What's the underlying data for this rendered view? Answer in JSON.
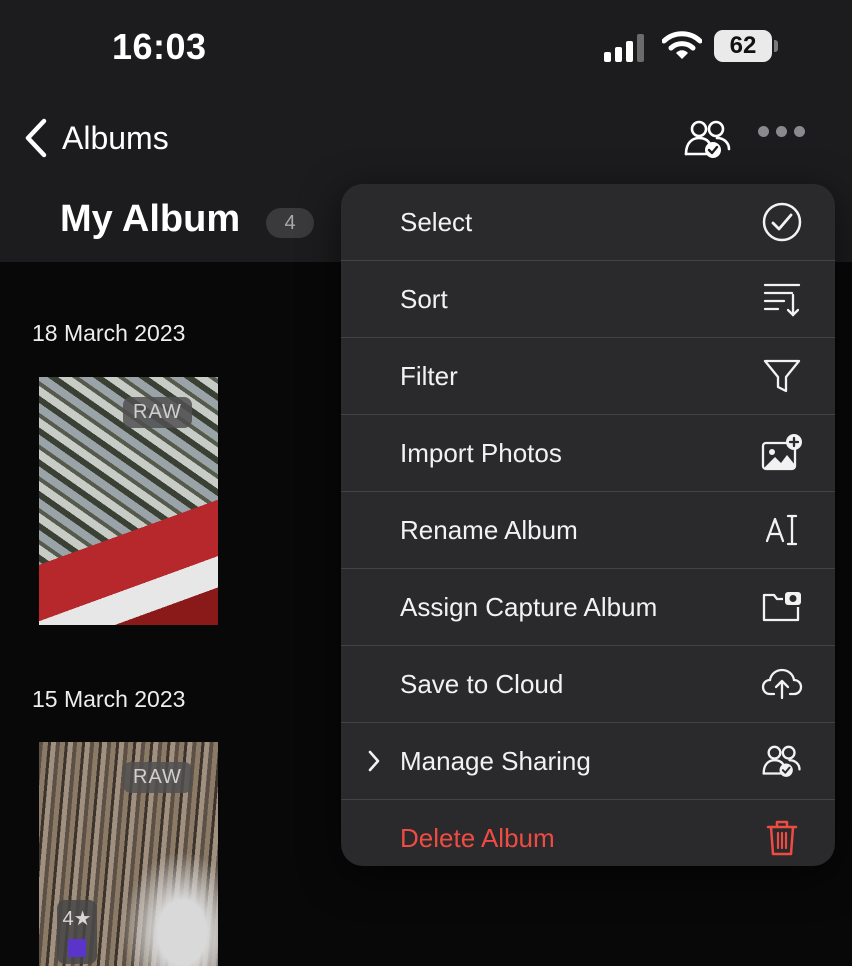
{
  "status_bar": {
    "time": "16:03",
    "battery": "62"
  },
  "nav": {
    "back_label": "Albums"
  },
  "album": {
    "title": "My Album",
    "count": "4"
  },
  "sections": [
    {
      "date": "18 March 2023",
      "photo": {
        "badge": "RAW"
      }
    },
    {
      "date": "15 March 2023",
      "photo": {
        "badge": "RAW",
        "rating": "4★",
        "color_label": "#5b34c9"
      }
    }
  ],
  "menu": {
    "items": [
      {
        "label": "Select",
        "icon": "checkmark-circle-icon"
      },
      {
        "label": "Sort",
        "icon": "sort-icon"
      },
      {
        "label": "Filter",
        "icon": "filter-icon"
      },
      {
        "label": "Import Photos",
        "icon": "photo-add-icon"
      },
      {
        "label": "Rename Album",
        "icon": "text-cursor-icon"
      },
      {
        "label": "Assign Capture Album",
        "icon": "folder-camera-icon"
      },
      {
        "label": "Save to Cloud",
        "icon": "cloud-upload-icon"
      },
      {
        "label": "Manage Sharing",
        "icon": "people-check-icon",
        "has_submenu": true
      },
      {
        "label": "Delete Album",
        "icon": "trash-icon",
        "destructive": true
      }
    ]
  },
  "colors": {
    "destructive": "#ee4b43",
    "menu_bg": "#2a2a2c",
    "header_bg": "#1c1c1e"
  }
}
